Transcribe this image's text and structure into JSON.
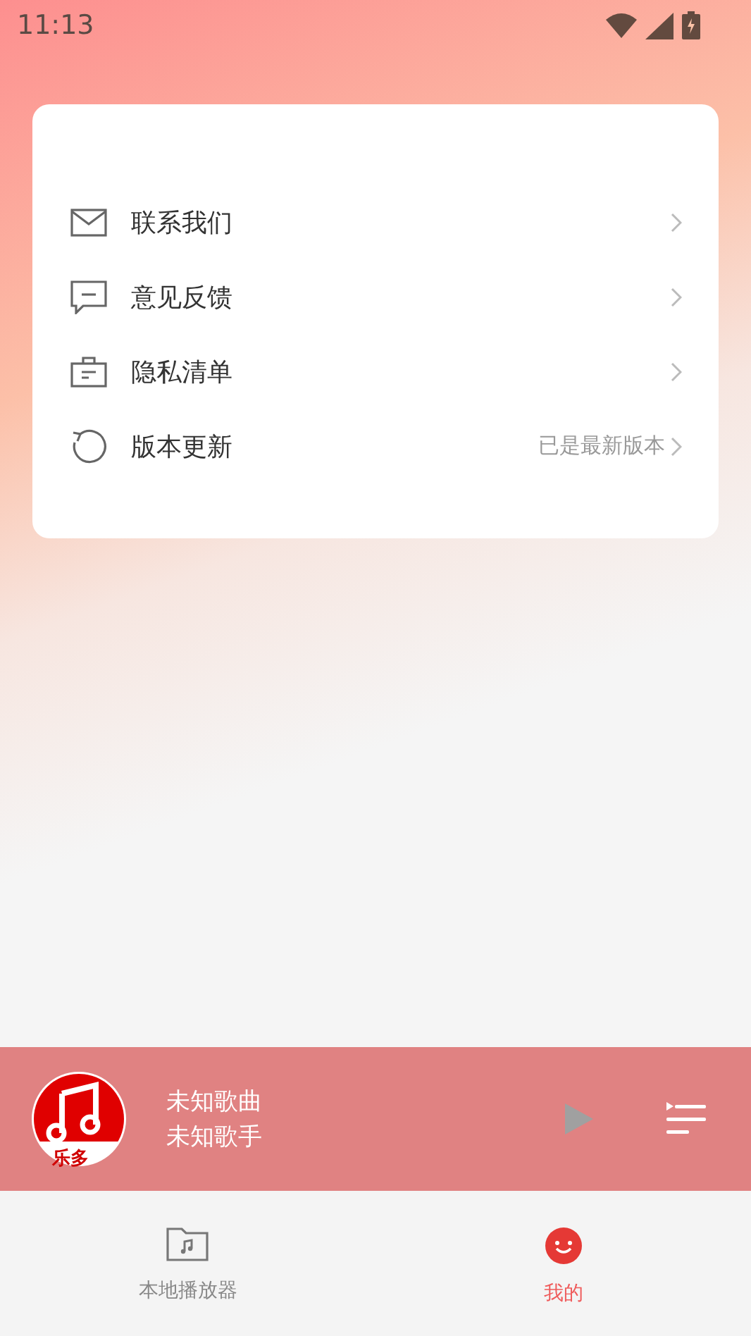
{
  "status_bar": {
    "time": "11:13"
  },
  "menu": [
    {
      "kind": "mail",
      "label": "联系我们"
    },
    {
      "kind": "feedback",
      "label": "意见反馈"
    },
    {
      "kind": "privacy",
      "label": "隐私清单"
    },
    {
      "kind": "update",
      "label": "版本更新",
      "value": "已是最新版本"
    }
  ],
  "player": {
    "cover_caption": "乐多",
    "title": "未知歌曲",
    "artist": "未知歌手"
  },
  "tabs": [
    {
      "kind": "folder",
      "label": "本地播放器",
      "selected": false
    },
    {
      "kind": "me",
      "label": "我的",
      "selected": true
    }
  ]
}
